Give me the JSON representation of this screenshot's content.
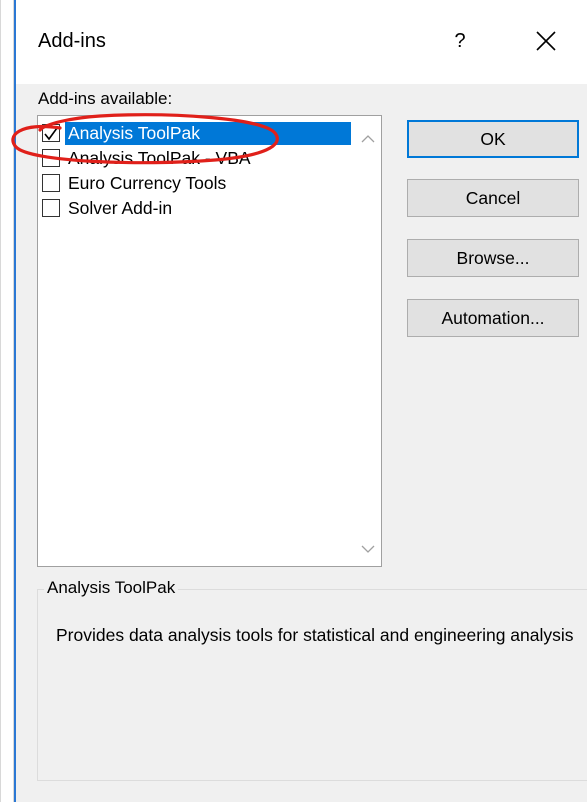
{
  "dialog": {
    "title": "Add-ins",
    "help_label": "?",
    "group_label": "Add-ins available:",
    "addins": [
      {
        "label": "Analysis ToolPak",
        "checked": true,
        "selected": true
      },
      {
        "label": "Analysis ToolPak - VBA",
        "checked": false,
        "selected": false
      },
      {
        "label": "Euro Currency Tools",
        "checked": false,
        "selected": false
      },
      {
        "label": "Solver Add-in",
        "checked": false,
        "selected": false
      }
    ],
    "buttons": {
      "ok": "OK",
      "cancel": "Cancel",
      "browse": "Browse...",
      "automation": "Automation..."
    },
    "details": {
      "legend": "Analysis ToolPak",
      "description": "Provides data analysis tools for statistical and engineering analysis"
    }
  },
  "colors": {
    "accent": "#0078d7",
    "annotation": "#e0201a",
    "dialog_bg": "#f0f0f0"
  }
}
